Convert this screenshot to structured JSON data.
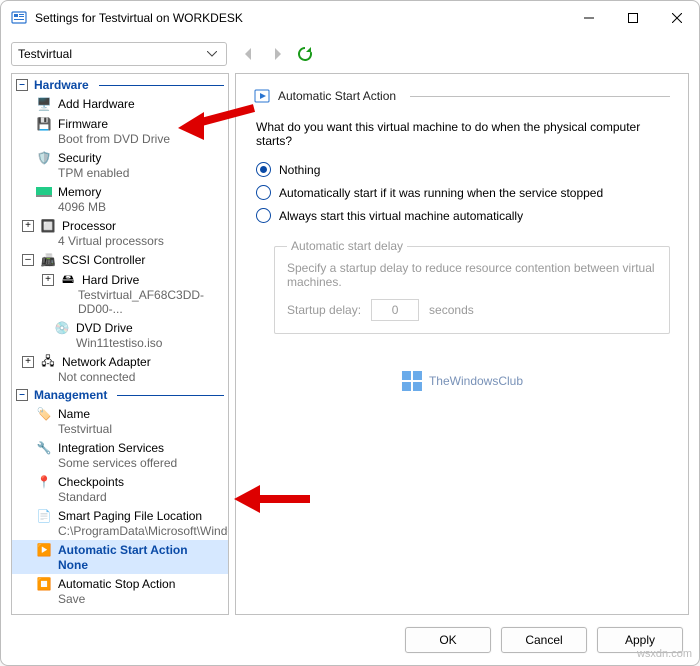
{
  "window": {
    "title": "Settings for Testvirtual on WORKDESK"
  },
  "toolbar": {
    "vm_selected": "Testvirtual"
  },
  "sidebar": {
    "hardware_header": "Hardware",
    "management_header": "Management",
    "items": {
      "add_hardware": {
        "label": "Add Hardware"
      },
      "firmware": {
        "label": "Firmware",
        "sub": "Boot from DVD Drive"
      },
      "security": {
        "label": "Security",
        "sub": "TPM enabled"
      },
      "memory": {
        "label": "Memory",
        "sub": "4096 MB"
      },
      "processor": {
        "label": "Processor",
        "sub": "4 Virtual processors"
      },
      "scsi": {
        "label": "SCSI Controller"
      },
      "hdd": {
        "label": "Hard Drive",
        "sub": "Testvirtual_AF68C3DD-DD00-..."
      },
      "dvd": {
        "label": "DVD Drive",
        "sub": "Win11testiso.iso"
      },
      "net": {
        "label": "Network Adapter",
        "sub": "Not connected"
      },
      "name": {
        "label": "Name",
        "sub": "Testvirtual"
      },
      "integration": {
        "label": "Integration Services",
        "sub": "Some services offered"
      },
      "checkpoints": {
        "label": "Checkpoints",
        "sub": "Standard"
      },
      "smartpaging": {
        "label": "Smart Paging File Location",
        "sub": "C:\\ProgramData\\Microsoft\\Windo..."
      },
      "autostart": {
        "label": "Automatic Start Action",
        "sub": "None"
      },
      "autostop": {
        "label": "Automatic Stop Action",
        "sub": "Save"
      }
    }
  },
  "pane": {
    "heading": "Automatic Start Action",
    "prompt": "What do you want this virtual machine to do when the physical computer starts?",
    "opt_nothing": "Nothing",
    "opt_auto_if_running": "Automatically start if it was running when the service stopped",
    "opt_always": "Always start this virtual machine automatically",
    "delay_legend": "Automatic start delay",
    "delay_desc": "Specify a startup delay to reduce resource contention between virtual machines.",
    "delay_label": "Startup delay:",
    "delay_value": "0",
    "delay_unit": "seconds"
  },
  "watermark": {
    "text": "TheWindowsClub"
  },
  "footer": {
    "ok": "OK",
    "cancel": "Cancel",
    "apply": "Apply"
  },
  "credit": "wsxdn.com"
}
